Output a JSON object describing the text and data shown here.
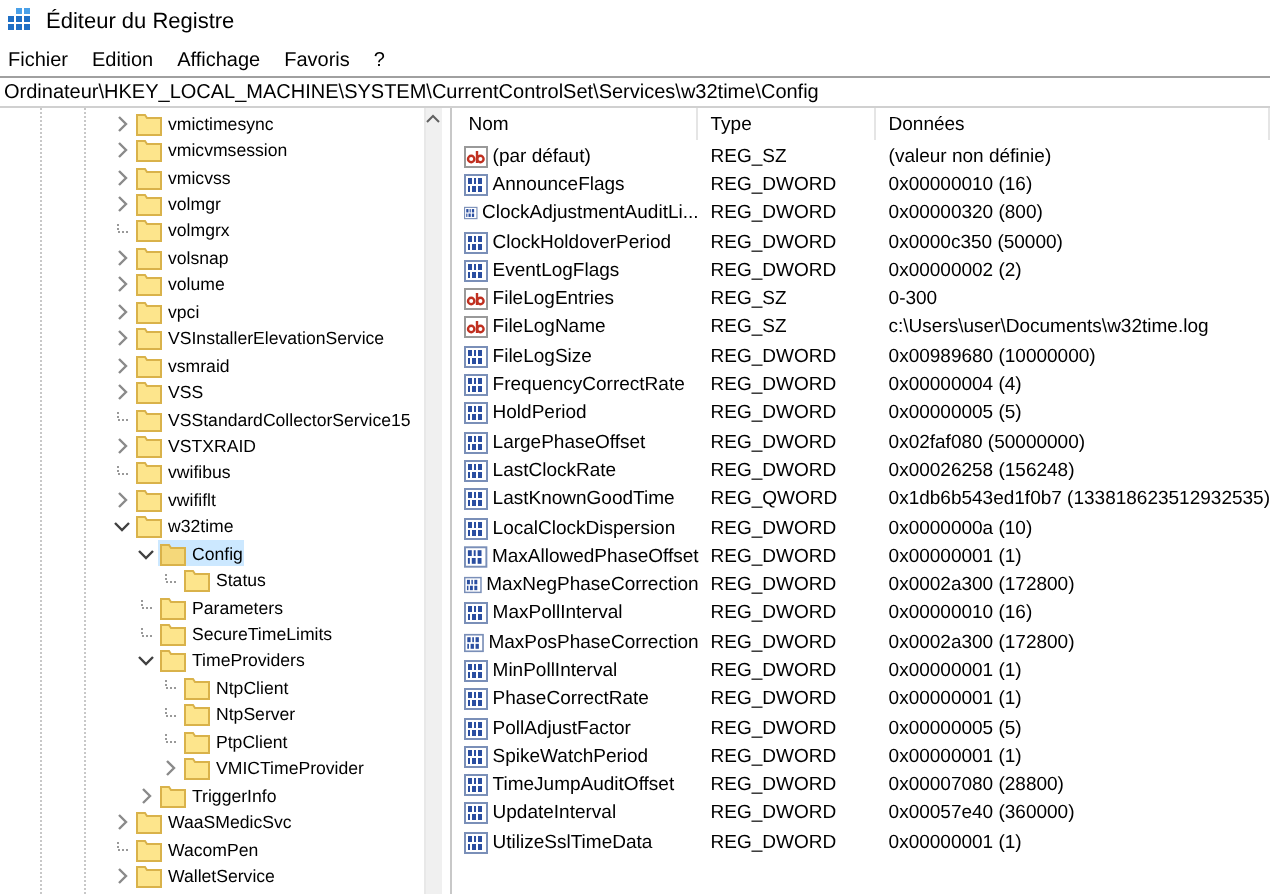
{
  "window": {
    "title": "Éditeur du Registre"
  },
  "menu": [
    "Fichier",
    "Edition",
    "Affichage",
    "Favoris",
    "?"
  ],
  "address": "Ordinateur\\HKEY_LOCAL_MACHINE\\SYSTEM\\CurrentControlSet\\Services\\w32time\\Config",
  "tree": [
    {
      "label": "vmictimesync",
      "expandable": true,
      "expanded": false,
      "selected": false
    },
    {
      "label": "vmicvmsession",
      "expandable": true,
      "expanded": false,
      "selected": false
    },
    {
      "label": "vmicvss",
      "expandable": true,
      "expanded": false,
      "selected": false
    },
    {
      "label": "volmgr",
      "expandable": true,
      "expanded": false,
      "selected": false
    },
    {
      "label": "volmgrx",
      "expandable": false,
      "selected": false
    },
    {
      "label": "volsnap",
      "expandable": true,
      "expanded": false,
      "selected": false
    },
    {
      "label": "volume",
      "expandable": true,
      "expanded": false,
      "selected": false
    },
    {
      "label": "vpci",
      "expandable": true,
      "expanded": false,
      "selected": false
    },
    {
      "label": "VSInstallerElevationService",
      "expandable": true,
      "expanded": false,
      "selected": false
    },
    {
      "label": "vsmraid",
      "expandable": true,
      "expanded": false,
      "selected": false
    },
    {
      "label": "VSS",
      "expandable": true,
      "expanded": false,
      "selected": false
    },
    {
      "label": "VSStandardCollectorService15",
      "expandable": false,
      "selected": false
    },
    {
      "label": "VSTXRAID",
      "expandable": true,
      "expanded": false,
      "selected": false
    },
    {
      "label": "vwifibus",
      "expandable": false,
      "selected": false
    },
    {
      "label": "vwififlt",
      "expandable": true,
      "expanded": false,
      "selected": false
    },
    {
      "label": "w32time",
      "expandable": true,
      "expanded": true,
      "selected": false,
      "children": [
        {
          "label": "Config",
          "expandable": true,
          "expanded": true,
          "selected": true,
          "children": [
            {
              "label": "Status",
              "expandable": false,
              "selected": false
            }
          ]
        },
        {
          "label": "Parameters",
          "expandable": false,
          "selected": false
        },
        {
          "label": "SecureTimeLimits",
          "expandable": false,
          "selected": false
        },
        {
          "label": "TimeProviders",
          "expandable": true,
          "expanded": true,
          "selected": false,
          "children": [
            {
              "label": "NtpClient",
              "expandable": false,
              "selected": false
            },
            {
              "label": "NtpServer",
              "expandable": false,
              "selected": false
            },
            {
              "label": "PtpClient",
              "expandable": false,
              "selected": false
            },
            {
              "label": "VMICTimeProvider",
              "expandable": true,
              "expanded": false,
              "selected": false
            }
          ]
        },
        {
          "label": "TriggerInfo",
          "expandable": true,
          "expanded": false,
          "selected": false
        }
      ]
    },
    {
      "label": "WaaSMedicSvc",
      "expandable": true,
      "expanded": false,
      "selected": false
    },
    {
      "label": "WacomPen",
      "expandable": false,
      "selected": false
    },
    {
      "label": "WalletService",
      "expandable": true,
      "expanded": false,
      "selected": false
    }
  ],
  "table": {
    "columns": [
      "Nom",
      "Type",
      "Données"
    ],
    "rows": [
      {
        "kind": "string",
        "name": "(par défaut)",
        "type": "REG_SZ",
        "data": "(valeur non définie)"
      },
      {
        "kind": "binary",
        "name": "AnnounceFlags",
        "type": "REG_DWORD",
        "data": "0x00000010 (16)"
      },
      {
        "kind": "binary",
        "name": "ClockAdjustmentAuditLi...",
        "type": "REG_DWORD",
        "data": "0x00000320 (800)"
      },
      {
        "kind": "binary",
        "name": "ClockHoldoverPeriod",
        "type": "REG_DWORD",
        "data": "0x0000c350 (50000)"
      },
      {
        "kind": "binary",
        "name": "EventLogFlags",
        "type": "REG_DWORD",
        "data": "0x00000002 (2)"
      },
      {
        "kind": "string",
        "name": "FileLogEntries",
        "type": "REG_SZ",
        "data": "0-300"
      },
      {
        "kind": "string",
        "name": "FileLogName",
        "type": "REG_SZ",
        "data": "c:\\Users\\user\\Documents\\w32time.log"
      },
      {
        "kind": "binary",
        "name": "FileLogSize",
        "type": "REG_DWORD",
        "data": "0x00989680 (10000000)"
      },
      {
        "kind": "binary",
        "name": "FrequencyCorrectRate",
        "type": "REG_DWORD",
        "data": "0x00000004 (4)"
      },
      {
        "kind": "binary",
        "name": "HoldPeriod",
        "type": "REG_DWORD",
        "data": "0x00000005 (5)"
      },
      {
        "kind": "binary",
        "name": "LargePhaseOffset",
        "type": "REG_DWORD",
        "data": "0x02faf080 (50000000)"
      },
      {
        "kind": "binary",
        "name": "LastClockRate",
        "type": "REG_DWORD",
        "data": "0x00026258 (156248)"
      },
      {
        "kind": "binary",
        "name": "LastKnownGoodTime",
        "type": "REG_QWORD",
        "data": "0x1db6b543ed1f0b7 (133818623512932535)"
      },
      {
        "kind": "binary",
        "name": "LocalClockDispersion",
        "type": "REG_DWORD",
        "data": "0x0000000a (10)"
      },
      {
        "kind": "binary",
        "name": "MaxAllowedPhaseOffset",
        "type": "REG_DWORD",
        "data": "0x00000001 (1)"
      },
      {
        "kind": "binary",
        "name": "MaxNegPhaseCorrection",
        "type": "REG_DWORD",
        "data": "0x0002a300 (172800)"
      },
      {
        "kind": "binary",
        "name": "MaxPollInterval",
        "type": "REG_DWORD",
        "data": "0x00000010 (16)"
      },
      {
        "kind": "binary",
        "name": "MaxPosPhaseCorrection",
        "type": "REG_DWORD",
        "data": "0x0002a300 (172800)"
      },
      {
        "kind": "binary",
        "name": "MinPollInterval",
        "type": "REG_DWORD",
        "data": "0x00000001 (1)"
      },
      {
        "kind": "binary",
        "name": "PhaseCorrectRate",
        "type": "REG_DWORD",
        "data": "0x00000001 (1)"
      },
      {
        "kind": "binary",
        "name": "PollAdjustFactor",
        "type": "REG_DWORD",
        "data": "0x00000005 (5)"
      },
      {
        "kind": "binary",
        "name": "SpikeWatchPeriod",
        "type": "REG_DWORD",
        "data": "0x00000001 (1)"
      },
      {
        "kind": "binary",
        "name": "TimeJumpAuditOffset",
        "type": "REG_DWORD",
        "data": "0x00007080 (28800)"
      },
      {
        "kind": "binary",
        "name": "UpdateInterval",
        "type": "REG_DWORD",
        "data": "0x00057e40 (360000)"
      },
      {
        "kind": "binary",
        "name": "UtilizeSslTimeData",
        "type": "REG_DWORD",
        "data": "0x00000001 (1)"
      }
    ]
  }
}
